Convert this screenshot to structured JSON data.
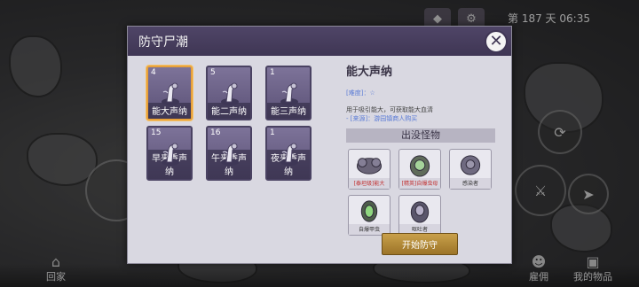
{
  "hud": {
    "day_label": "第 187 天",
    "time": "06:35",
    "gem_icon": "gem-icon",
    "settings_icon": "gear-icon"
  },
  "bottom_nav": {
    "home_label": "回家",
    "hire_label": "雇佣",
    "items_label": "我的物品"
  },
  "dialog": {
    "title": "防守尸潮",
    "close_icon": "close-icon",
    "waves": [
      {
        "count": "4",
        "label": "能大声纳"
      },
      {
        "count": "5",
        "label": "能二声纳"
      },
      {
        "count": "1",
        "label": "能三声纳"
      },
      {
        "count": "15",
        "label": "早来香声纳"
      },
      {
        "count": "16",
        "label": "午来香声纳"
      },
      {
        "count": "1",
        "label": "夜来香声纳"
      }
    ],
    "detail": {
      "name": "能大声纳",
      "difficulty": "[难度]：☆",
      "description": "用于吸引能大，可获取能大血清",
      "source": "- [来源]：游园镇商人购买",
      "section_title": "出没怪物",
      "monsters": [
        {
          "label": "[泰坦级]能大",
          "highlight": true
        },
        {
          "label": "[精英]自爆虫母",
          "highlight": true
        },
        {
          "label": "感染者",
          "highlight": false
        },
        {
          "label": "自爆甲虫",
          "highlight": false
        },
        {
          "label": "呕吐者",
          "highlight": false
        }
      ]
    },
    "start_button": "开始防守"
  },
  "colors": {
    "header": "#4f4567",
    "card": "#6d6389",
    "selected_border": "#e8a13a",
    "start_button": "#b58a38",
    "highlight_text": "#c23030"
  }
}
